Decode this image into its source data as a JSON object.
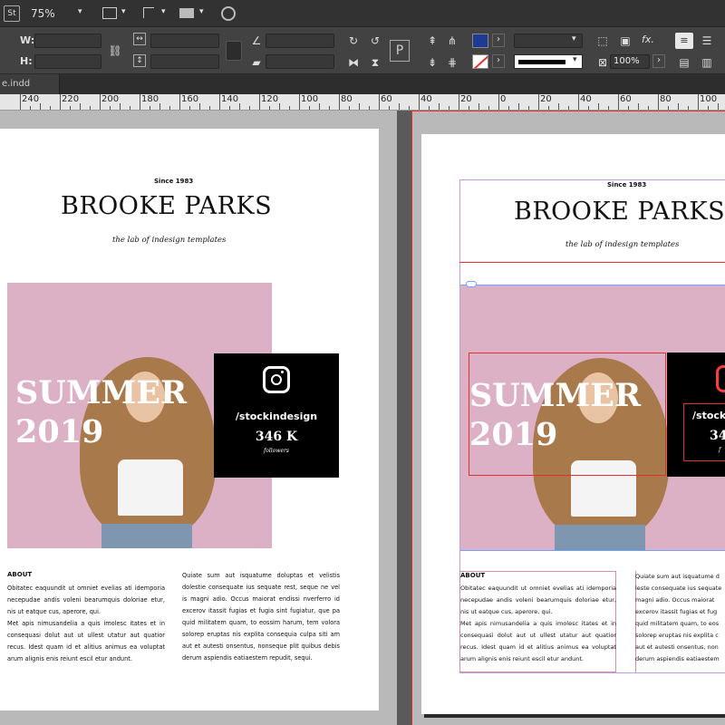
{
  "app": {
    "logo": "St",
    "zoom": "75%",
    "tab_label": "e.indd"
  },
  "control_panel": {
    "w_label": "W:",
    "h_label": "H:",
    "opacity_value": "100%",
    "fx_label": "fx."
  },
  "colors": {
    "fill_swatch": "#1f3a93",
    "accent_frame": "#e0312e",
    "guide": "#6aa5ff",
    "photo_bg": "#dcb1c6"
  },
  "ruler": {
    "ticks": [
      "240",
      "220",
      "200",
      "180",
      "160",
      "140",
      "120",
      "100",
      "80",
      "60",
      "40",
      "20",
      "0",
      "20",
      "40",
      "60",
      "80",
      "100"
    ]
  },
  "left_page": {
    "since": "Since 1983",
    "brand": "BROOKE PARKS",
    "tagline": "the lab of indesign templates",
    "hero_line1": "SUMMER",
    "hero_line2": "2019",
    "handle": "/stockindesign",
    "followers_count": "346 K",
    "followers_label": "followers",
    "about_heading": "ABOUT",
    "col1_p1": "Obitatec eaquundit ut omniet evelias ati idemporia necepudae andis voleni bearumquis doloriae etur, nis ut eatque cus, aperore, qui.",
    "col1_p2": "Met apis nimusandelia a quis imolesc itates et in consequasi dolut aut ut ullest utatur aut quatior recus. Idest quam id et alitius animus ea voluptat arum alignis enis reiunt escil etur andunt.",
    "col2": "Quiate sum aut isquatume doluptas et velistis dolestie consequate ius sequate rest, seque ne vel is magni adio. Occus maiorat endissi nverferro id excerov itassit fugias et fugia sint fugiatur, que pa quid militatem quam, to eossim harum, tem volora solorep eruptas nis explita consequia culpa siti am aut et autesti onsentus, nonseque plit quibus debis derum aspiendis eatiaestem repudit, sequi."
  },
  "right_page": {
    "since": "Since 1983",
    "brand": "BROOKE PARKS",
    "tagline": "the lab of indesign templates",
    "hero_line1": "SUMMER",
    "hero_line2": "2019",
    "handle": "/stock",
    "followers_count": "34",
    "followers_label": "f",
    "about_heading": "ABOUT",
    "col1_p1": "Obitatec eaquundit ut omniet evelias ati idemporia necepudae andis voleni bearumquis doloriae etur, nis ut eatque cus, aperore, qui.",
    "col1_p2": "Met apis nimusandelia a quis imolesc itates et in consequasi dolut aut ut ullest utatur aut quatior recus. Idest quam id et alitius animus ea voluptat arum alignis enis reiunt escil etur andunt.",
    "col2": "Quiate sum aut isquatume d leste consequate ius sequate magni adio. Occus maiorat excerov itassit fugias et fug quid militatem quam, to eos solorep eruptas nis explita c aut et autesti onsentus, non derum aspiendis eatiaestem"
  }
}
